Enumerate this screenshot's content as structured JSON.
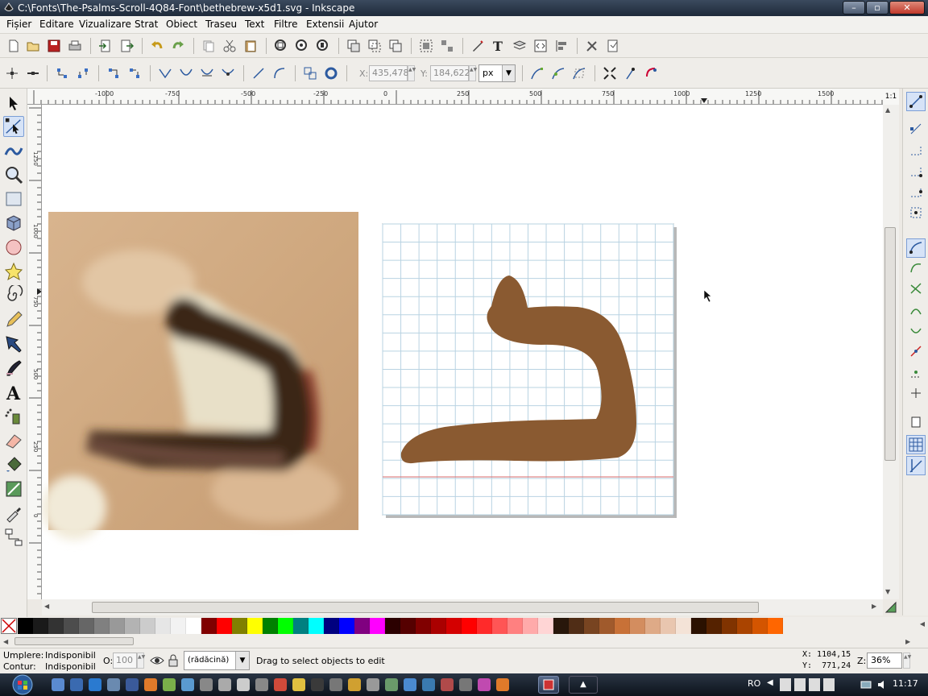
{
  "window": {
    "title": "C:\\Fonts\\The-Psalms-Scroll-4Q84-Font\\bethebrew-x5d1.svg - Inkscape",
    "minimize": "–",
    "maximize": "▫",
    "close": "✕"
  },
  "menu": [
    "Fișier",
    "Editare",
    "Vizualizare",
    "Strat",
    "Obiect",
    "Traseu",
    "Text",
    "Filtre",
    "Extensii",
    "Ajutor"
  ],
  "controls": {
    "x_label": "X:",
    "x_value": "435,478",
    "y_label": "Y:",
    "y_value": "184,622",
    "unit": "px"
  },
  "ruler_top": [
    "-1000",
    "-750",
    "-500",
    "-250",
    "0",
    "250",
    "500",
    "750",
    "1000",
    "1250",
    "1500"
  ],
  "ruler_left": [
    "1250",
    "1000",
    "750",
    "500",
    "250",
    "0"
  ],
  "zoom_corner": "1:1",
  "status": {
    "fill_label": "Umplere:",
    "fill_value": "Indisponibil",
    "stroke_label": "Contur:",
    "stroke_value": "Indisponibil",
    "opacity_label": "O:",
    "opacity_value": "100",
    "layer": "(rădăcină)",
    "message": "Drag to select objects to edit",
    "cursor_x": "X: 1104,15",
    "cursor_y": "Y:  771,24",
    "zoom_label": "Z:",
    "zoom_value": "36%"
  },
  "taskbar": {
    "language": "RO",
    "clock": "11:17"
  },
  "palette": [
    "#000000",
    "#1a1a1a",
    "#333333",
    "#4d4d4d",
    "#666666",
    "#808080",
    "#999999",
    "#b3b3b3",
    "#cccccc",
    "#e6e6e6",
    "#f2f2f2",
    "#ffffff",
    "#800000",
    "#ff0000",
    "#808000",
    "#ffff00",
    "#008000",
    "#00ff00",
    "#008080",
    "#00ffff",
    "#000080",
    "#0000ff",
    "#800080",
    "#ff00ff",
    "#2b0000",
    "#550000",
    "#800000",
    "#aa0000",
    "#d40000",
    "#ff0000",
    "#ff2a2a",
    "#ff5555",
    "#ff8080",
    "#ffaaaa",
    "#ffd5d5",
    "#28170b",
    "#502d16",
    "#784421",
    "#a05a2c",
    "#c87137",
    "#d38d5f",
    "#deaa87",
    "#e9c6af",
    "#f4e3d7",
    "#2b1100",
    "#552200",
    "#803300",
    "#aa4400",
    "#d45500",
    "#ff6600"
  ],
  "colors": {
    "glyph_fill": "#8a5a31",
    "grid_line": "#b9d3e2",
    "baseline": "#d96b6b"
  }
}
